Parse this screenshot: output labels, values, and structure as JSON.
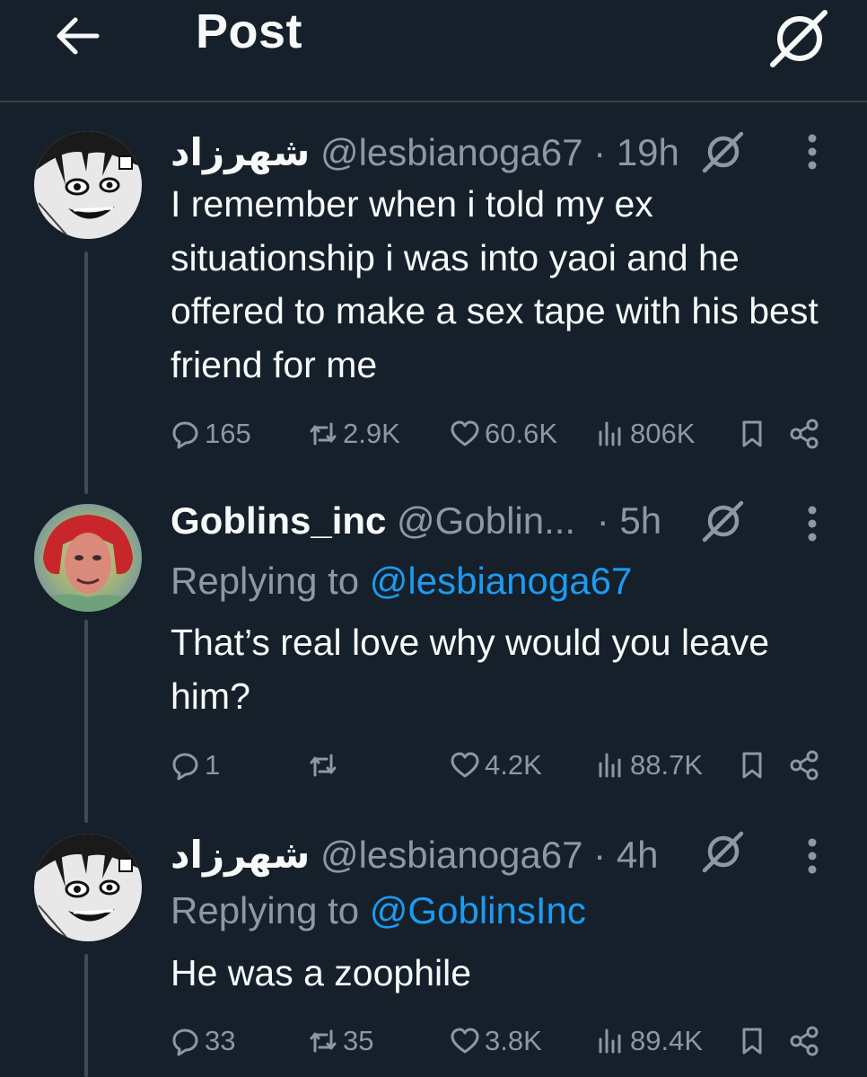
{
  "header": {
    "title": "Post"
  },
  "colors": {
    "background": "#15202b",
    "text": "#f7f9f9",
    "muted": "#8b98a5",
    "link": "#1d9bf0",
    "divider": "#38444d"
  },
  "tweets": [
    {
      "name": "شهرزاد",
      "handle": "@lesbianoga67",
      "time": "· 19h",
      "reply_prefix": "",
      "reply_mention": "",
      "text": "I remember when i told my ex situationship i was into yaoi and he offered to make a sex tape with his best friend for me",
      "replies": "165",
      "retweets": "2.9K",
      "likes": "60.6K",
      "views": "806K"
    },
    {
      "name": "Goblins_inc",
      "handle": "@Goblin...",
      "time": "· 5h",
      "reply_prefix": "Replying to ",
      "reply_mention": "@lesbianoga67",
      "text": "That’s real love why would you leave him?",
      "replies": "1",
      "retweets": "",
      "likes": "4.2K",
      "views": "88.7K"
    },
    {
      "name": "شهرزاد",
      "handle": "@lesbianoga67",
      "time": "· 4h",
      "reply_prefix": "Replying to ",
      "reply_mention": "@GoblinsInc",
      "text": "He was a zoophile",
      "replies": "33",
      "retweets": "35",
      "likes": "3.8K",
      "views": "89.4K"
    }
  ],
  "icons": [
    "back-arrow-icon",
    "grok-icon",
    "more-icon",
    "reply-icon",
    "retweet-icon",
    "like-icon",
    "views-icon",
    "bookmark-icon",
    "share-icon"
  ]
}
